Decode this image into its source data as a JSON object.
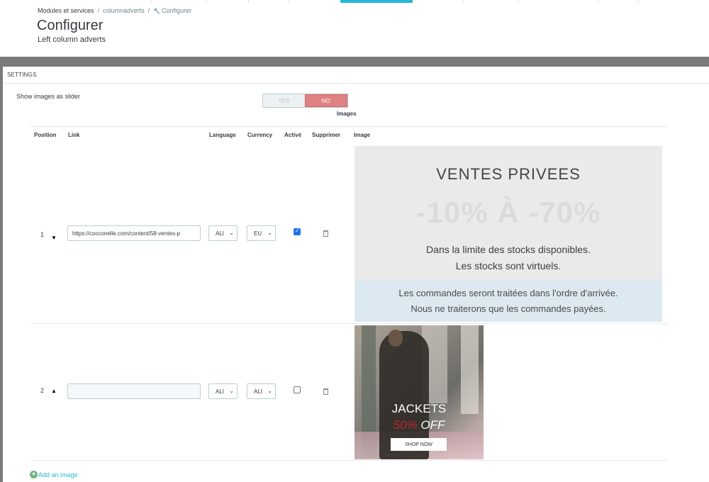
{
  "breadcrumb": {
    "item1": "Modules et services",
    "item2": "columnadverts",
    "item3": "Configurer"
  },
  "header": {
    "title": "Configurer",
    "subtitle": "Left column adverts"
  },
  "panel": {
    "heading": "SETTINGS",
    "slider_label": "Show images as slider",
    "switch": {
      "yes": "YES",
      "no": "NO",
      "selected": "NO"
    },
    "images_title": "Images"
  },
  "table": {
    "columns": {
      "position": "Position",
      "link": "Link",
      "language": "Language",
      "currency": "Currency",
      "active": "Activé",
      "delete": "Supprimer",
      "image": "Image"
    },
    "rows": [
      {
        "position": "1",
        "arrow": "▼",
        "link": "https://cocconelle.com/content/58-ventes-p",
        "language": "ALI",
        "currency": "EU",
        "active": true
      },
      {
        "position": "2",
        "arrow": "▲",
        "link": "",
        "language": "ALI",
        "currency": "ALI",
        "active": false
      }
    ]
  },
  "ad1": {
    "title": "VENTES PRIVEES",
    "percent": "-10% À -70%",
    "line1": "Dans la limite des stocks disponibles.",
    "line2": "Les stocks sont virtuels.",
    "band1": "Les commandes seront traitées dans l'ordre d'arrivée.",
    "band2": "Nous ne traiterons que les commandes payées."
  },
  "ad2": {
    "title": "JACKETS",
    "pct": "50%",
    "off": "OFF",
    "button": "SHOP NOW"
  },
  "add_image": "Add an image",
  "icons": {
    "wrench": "wrench-icon",
    "trash": "trash-icon",
    "plus": "plus-circle-icon"
  },
  "colors": {
    "accent": "#25b9d7",
    "no_switch": "#e08184",
    "add_plus": "#70b580"
  }
}
